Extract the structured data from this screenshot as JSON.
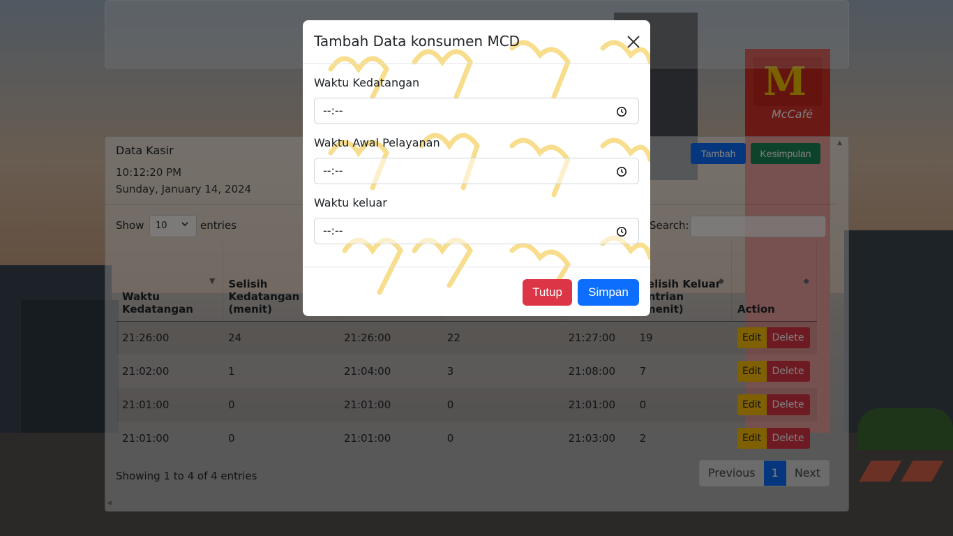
{
  "page": {
    "card_title": "Data Kasir",
    "time": "10:12:20 PM",
    "date": "Sunday, January 14, 2024",
    "add_button": "Tambah",
    "summary_button": "Kesimpulan",
    "show_label": "Show",
    "entries_select_value": "10",
    "entries_label": "entries",
    "search_label": "Search:",
    "info_text": "Showing 1 to 4 of 4 entries",
    "pagination": {
      "previous": "Previous",
      "current": "1",
      "next": "Next"
    }
  },
  "table": {
    "headers": [
      "Waktu Kedatangan",
      "Selisih Kedatangan (menit)",
      "",
      "",
      "",
      "Selisih Keluar Antrian (menit)",
      "Action"
    ],
    "rows": [
      [
        "21:26:00",
        "24",
        "21:26:00",
        "22",
        "21:27:00",
        "19"
      ],
      [
        "21:02:00",
        "1",
        "21:04:00",
        "3",
        "21:08:00",
        "7"
      ],
      [
        "21:01:00",
        "0",
        "21:01:00",
        "0",
        "21:01:00",
        "0"
      ],
      [
        "21:01:00",
        "0",
        "21:01:00",
        "0",
        "21:03:00",
        "2"
      ]
    ],
    "edit_label": "Edit",
    "delete_label": "Delete"
  },
  "modal": {
    "title": "Tambah Data konsumen MCD",
    "fields": [
      {
        "label": "Waktu Kedatangan",
        "value": "--:--"
      },
      {
        "label": "Waktu Awal Pelayanan",
        "value": "--:--"
      },
      {
        "label": "Waktu keluar",
        "value": "--:--"
      }
    ],
    "close_button": "Tutup",
    "save_button": "Simpan"
  },
  "colors": {
    "primary": "#0d6efd",
    "success": "#198754",
    "danger": "#dc3545",
    "warning": "#ffc107",
    "pattern": "#f2c230"
  },
  "icons": [
    "close-icon",
    "clock-icon",
    "chevron-down-icon",
    "sort-icon"
  ]
}
